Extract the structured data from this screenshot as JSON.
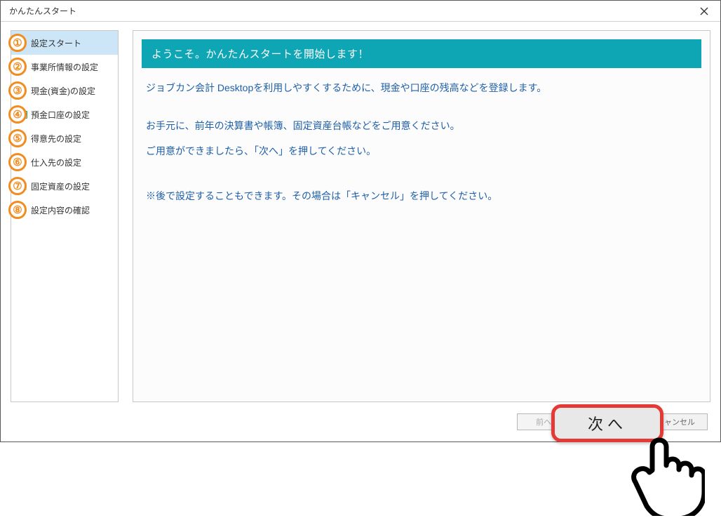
{
  "window": {
    "title": "かんたんスタート"
  },
  "sidebar": {
    "items": [
      {
        "label": "設定スタート"
      },
      {
        "label": "事業所情報の設定"
      },
      {
        "label": "現金(資金)の設定"
      },
      {
        "label": "預金口座の設定"
      },
      {
        "label": "得意先の設定"
      },
      {
        "label": "仕入先の設定"
      },
      {
        "label": "固定資産の設定"
      },
      {
        "label": "設定内容の確認"
      }
    ]
  },
  "main": {
    "banner": "ようこそ。かんたんスタートを開始します！",
    "p1": "ジョブカン会計 Desktopを利用しやすくするために、現金や口座の残高などを登録します。",
    "p2": "お手元に、前年の決算書や帳簿、固定資産台帳などをご用意ください。",
    "p3": "ご用意ができましたら、「次へ」を押してください。",
    "p4": "※後で設定することもできます。その場合は「キャンセル」を押してください。"
  },
  "footer": {
    "prev": "前へ(",
    "next": "次へ",
    "cancel": "ャンセル"
  },
  "highlight": {
    "next": "次へ"
  },
  "badges": [
    "①",
    "②",
    "③",
    "④",
    "⑤",
    "⑥",
    "⑦",
    "⑧"
  ]
}
